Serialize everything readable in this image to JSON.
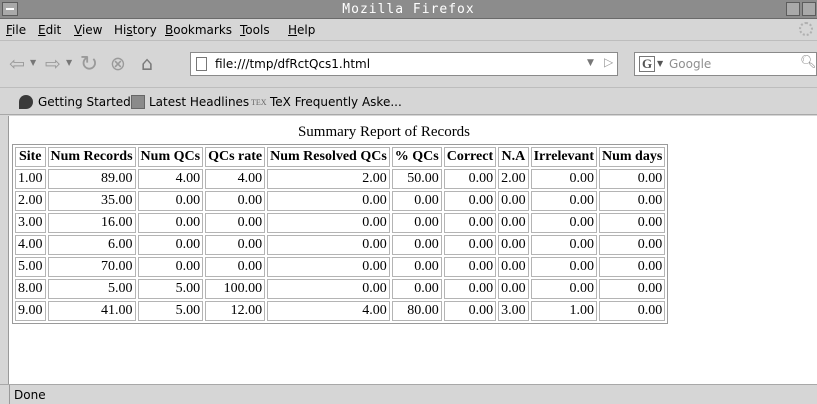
{
  "window": {
    "title": "Mozilla Firefox"
  },
  "menu": [
    {
      "key": "F",
      "rest": "ile"
    },
    {
      "key": "E",
      "rest": "dit"
    },
    {
      "key": "V",
      "rest": "iew"
    },
    {
      "pre": "Hi",
      "key": "s",
      "rest": "tory"
    },
    {
      "key": "B",
      "rest": "ookmarks"
    },
    {
      "key": "T",
      "rest": "ools"
    },
    {
      "key": "H",
      "rest": "elp"
    }
  ],
  "nav": {
    "url": "file:///tmp/dfRctQcs1.html",
    "search_placeholder": "Google",
    "icons": {
      "back": "back-arrow-icon",
      "forward": "forward-arrow-icon",
      "reload": "reload-icon",
      "stop": "stop-icon",
      "home": "home-icon"
    }
  },
  "bookmarks": [
    {
      "label": "Getting Started",
      "icon": "leaf-icon"
    },
    {
      "label": "Latest Headlines",
      "icon": "rss-icon"
    },
    {
      "label": "TeX Frequently Aske...",
      "icon": "tex-icon",
      "icon_text": "TEX"
    }
  ],
  "report": {
    "title": "Summary Report of Records",
    "columns": [
      "Site",
      "Num Records",
      "Num QCs",
      "QCs rate",
      "Num Resolved QCs",
      "% QCs",
      "Correct",
      "N.A",
      "Irrelevant",
      "Num days"
    ],
    "rows": [
      [
        "1.00",
        "89.00",
        "4.00",
        "4.00",
        "2.00",
        "50.00",
        "0.00",
        "2.00",
        "0.00",
        "0.00"
      ],
      [
        "2.00",
        "35.00",
        "0.00",
        "0.00",
        "0.00",
        "0.00",
        "0.00",
        "0.00",
        "0.00",
        "0.00"
      ],
      [
        "3.00",
        "16.00",
        "0.00",
        "0.00",
        "0.00",
        "0.00",
        "0.00",
        "0.00",
        "0.00",
        "0.00"
      ],
      [
        "4.00",
        "6.00",
        "0.00",
        "0.00",
        "0.00",
        "0.00",
        "0.00",
        "0.00",
        "0.00",
        "0.00"
      ],
      [
        "5.00",
        "70.00",
        "0.00",
        "0.00",
        "0.00",
        "0.00",
        "0.00",
        "0.00",
        "0.00",
        "0.00"
      ],
      [
        "8.00",
        "5.00",
        "5.00",
        "100.00",
        "0.00",
        "0.00",
        "0.00",
        "0.00",
        "0.00",
        "0.00"
      ],
      [
        "9.00",
        "41.00",
        "5.00",
        "12.00",
        "4.00",
        "80.00",
        "0.00",
        "3.00",
        "1.00",
        "0.00"
      ]
    ]
  },
  "status": {
    "text": "Done"
  }
}
